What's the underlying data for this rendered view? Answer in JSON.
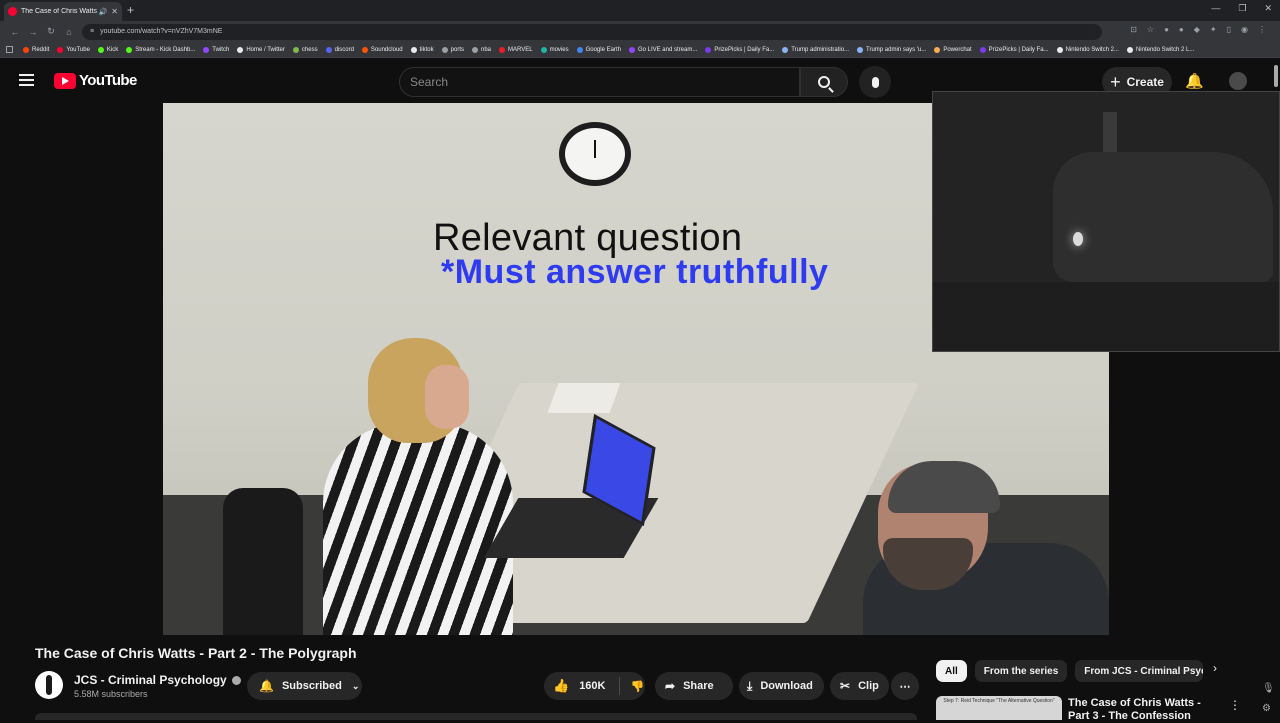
{
  "browser": {
    "tab_title": "The Case of Chris Watts - P",
    "url": "youtube.com/watch?v=nVZhV7M3mNE",
    "bookmarks": [
      {
        "label": "Reddit",
        "color": "#ff4500"
      },
      {
        "label": "YouTube",
        "color": "#ff0033"
      },
      {
        "label": "Kick",
        "color": "#53fc18"
      },
      {
        "label": "Stream - Kick Dashb...",
        "color": "#53fc18"
      },
      {
        "label": "Twitch",
        "color": "#9146ff"
      },
      {
        "label": "Home / Twitter",
        "color": "#e8eaed"
      },
      {
        "label": "chess",
        "color": "#81b64c"
      },
      {
        "label": "discord",
        "color": "#5865f2"
      },
      {
        "label": "Soundcloud",
        "color": "#ff5500"
      },
      {
        "label": "tiktok",
        "color": "#e8eaed"
      },
      {
        "label": "ports",
        "color": "#9aa0a6"
      },
      {
        "label": "nba",
        "color": "#9aa0a6"
      },
      {
        "label": "MARVEL",
        "color": "#ec1d24"
      },
      {
        "label": "movies",
        "color": "#1fb6a6"
      },
      {
        "label": "Google Earth",
        "color": "#4285f4"
      },
      {
        "label": "Go LIVE and stream...",
        "color": "#9146ff"
      },
      {
        "label": "PrizePicks | Daily Fa...",
        "color": "#7c3aed"
      },
      {
        "label": "Trump administratio...",
        "color": "#8ab4f8"
      },
      {
        "label": "Trump admin says 'u...",
        "color": "#8ab4f8"
      },
      {
        "label": "Powerchat",
        "color": "#f6ad55"
      },
      {
        "label": "PrizePicks | Daily Fa...",
        "color": "#7c3aed"
      },
      {
        "label": "Nintendo Switch 2...",
        "color": "#e8eaed"
      },
      {
        "label": "Nintendo Switch 2 L...",
        "color": "#e8eaed"
      }
    ]
  },
  "header": {
    "logo_text": "YouTube",
    "search_placeholder": "Search",
    "create_label": "Create"
  },
  "video": {
    "overlay_title": "Relevant question",
    "overlay_subtitle": "*Must answer truthfully",
    "title": "The Case of Chris Watts - Part 2 - The Polygraph"
  },
  "channel": {
    "name": "JCS - Criminal Psychology",
    "subscribers": "5.58M subscribers",
    "subscribe_label": "Subscribed"
  },
  "actions": {
    "likes": "160K",
    "share": "Share",
    "download": "Download",
    "clip": "Clip"
  },
  "chips": {
    "all": "All",
    "series": "From the series",
    "channel": "From JCS - Criminal Psychology"
  },
  "recommendation": {
    "title": "The Case of Chris Watts - Part 3 - The Confession",
    "thumb_text": "Step 7: Reid Technique \"The Alternative Question\""
  }
}
